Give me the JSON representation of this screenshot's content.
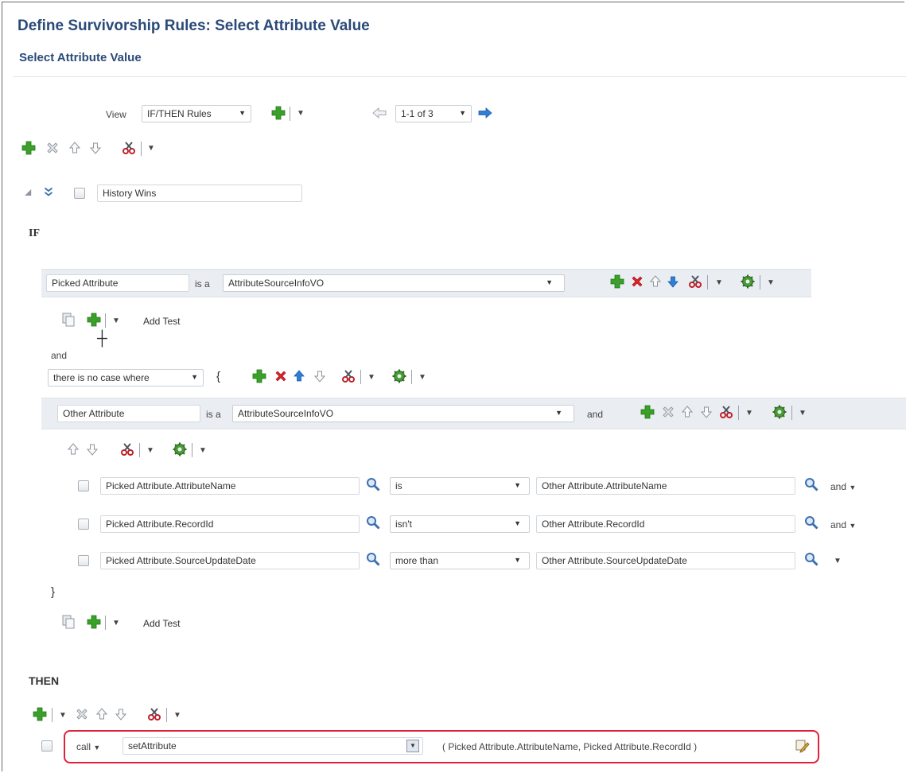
{
  "page": {
    "title": "Define Survivorship Rules: Select Attribute Value",
    "subtitle": "Select Attribute Value"
  },
  "toolbar": {
    "view_label": "View",
    "view_value": "IF/THEN Rules",
    "pager_value": "1-1 of 3"
  },
  "rule": {
    "name": "History Wins"
  },
  "if_section": {
    "label": "IF",
    "pattern1": {
      "variable": "Picked Attribute",
      "is_a": "is a",
      "fact_type": "AttributeSourceInfoVO"
    },
    "add_test_label": "Add Test",
    "and_label": "and",
    "quantifier": "there is no case where",
    "open_brace": "{",
    "close_brace": "}",
    "pattern2": {
      "variable": "Other Attribute",
      "is_a": "is a",
      "fact_type": "AttributeSourceInfoVO",
      "connector": "and"
    },
    "tests": [
      {
        "left": "Picked Attribute.AttributeName",
        "operator": "is",
        "right": "Other Attribute.AttributeName",
        "connector": "and"
      },
      {
        "left": "Picked Attribute.RecordId",
        "operator": "isn't",
        "right": "Other Attribute.RecordId",
        "connector": "and"
      },
      {
        "left": "Picked Attribute.SourceUpdateDate",
        "operator": "more than",
        "right": "Other Attribute.SourceUpdateDate",
        "connector": ""
      }
    ],
    "add_test_label2": "Add Test"
  },
  "then_section": {
    "label": "THEN",
    "action_type": "call",
    "function": "setAttribute",
    "arguments": "( Picked Attribute.AttributeName, Picked Attribute.RecordId )"
  },
  "colors": {
    "title": "#2a4a78",
    "add_green": "#3aa029",
    "delete_red": "#d8232a",
    "arrow_blue": "#2f7fd6",
    "highlight_red": "#e0223a",
    "shaded_row": "#eaedf1"
  }
}
